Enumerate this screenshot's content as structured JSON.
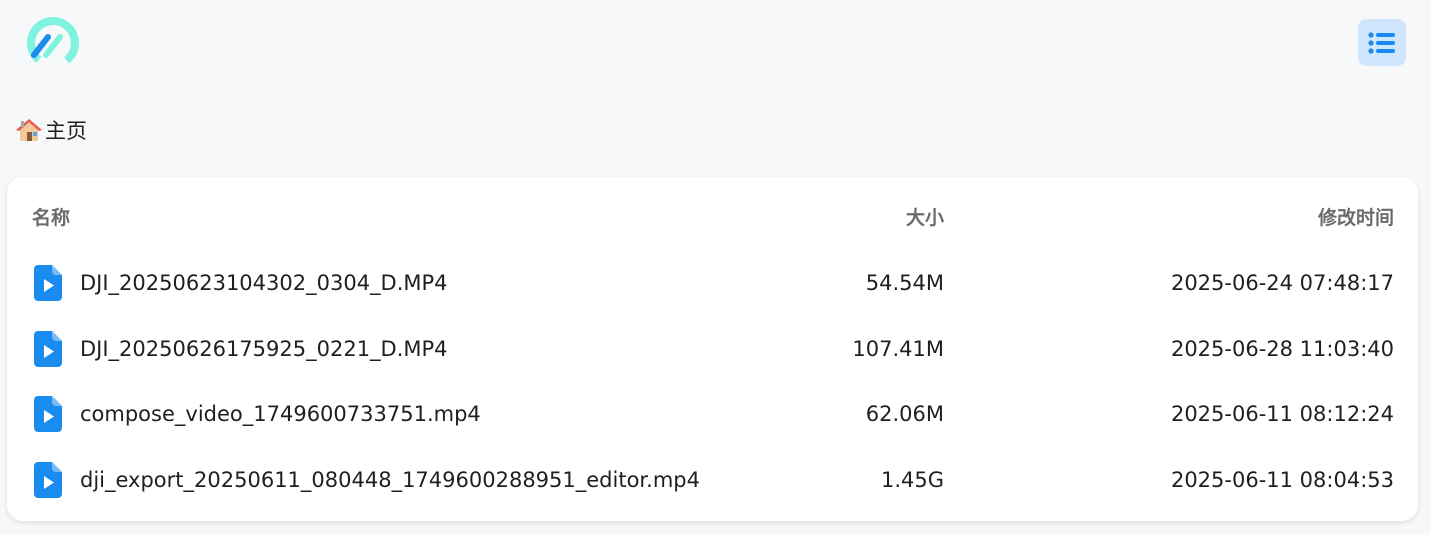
{
  "header": {
    "logo_icon": "app-logo-icon",
    "menu_icon": "list-icon",
    "accent_color": "#1a8cf0"
  },
  "breadcrumb": {
    "home_icon": "house-icon",
    "label": "主页"
  },
  "table": {
    "columns": {
      "name": "名称",
      "size": "大小",
      "modified": "修改时间"
    },
    "rows": [
      {
        "name": "DJI_20250623104302_0304_D.MP4",
        "size": "54.54M",
        "modified": "2025-06-24 07:48:17",
        "icon": "video-file-icon"
      },
      {
        "name": "DJI_20250626175925_0221_D.MP4",
        "size": "107.41M",
        "modified": "2025-06-28 11:03:40",
        "icon": "video-file-icon"
      },
      {
        "name": "compose_video_1749600733751.mp4",
        "size": "62.06M",
        "modified": "2025-06-11 08:12:24",
        "icon": "video-file-icon"
      },
      {
        "name": "dji_export_20250611_080448_1749600288951_editor.mp4",
        "size": "1.45G",
        "modified": "2025-06-11 08:04:53",
        "icon": "video-file-icon"
      }
    ]
  }
}
